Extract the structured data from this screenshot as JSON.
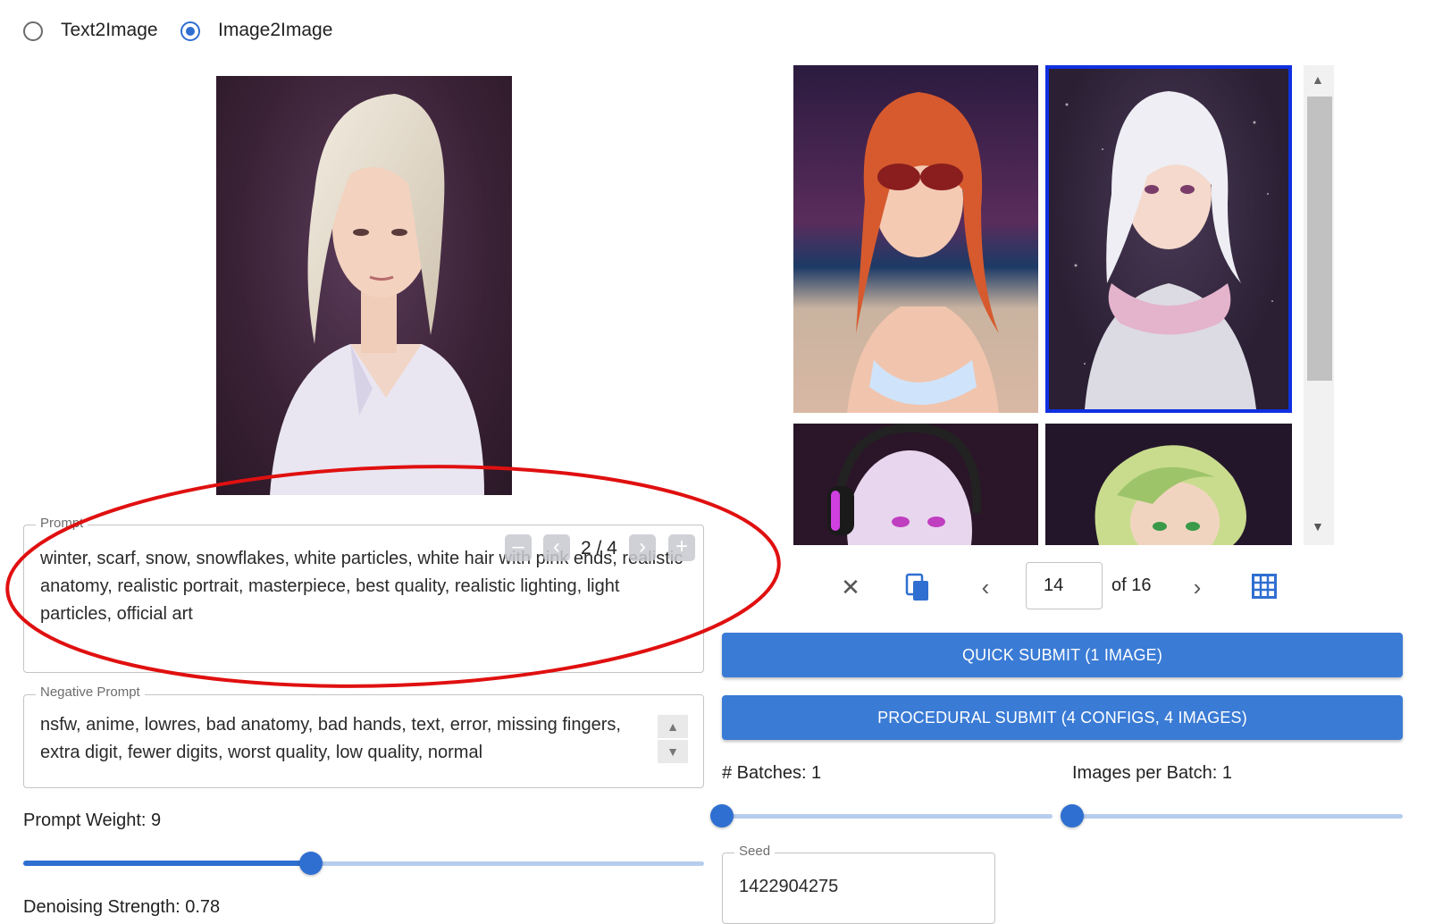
{
  "mode": {
    "options": [
      {
        "label": "Text2Image",
        "selected": false
      },
      {
        "label": "Image2Image",
        "selected": true
      }
    ]
  },
  "prompt": {
    "legend": "Prompt",
    "value": "winter, scarf, snow, snowflakes, white particles, white hair with pink ends, realistic anatomy, realistic portrait, masterpiece, best quality, realistic lighting, light particles, official art",
    "pager": {
      "current": 2,
      "total": 4,
      "text": "2 / 4"
    }
  },
  "negative_prompt": {
    "legend": "Negative Prompt",
    "value": "nsfw, anime, lowres, bad anatomy, bad hands, text, error, missing fingers, extra digit, fewer digits, worst quality, low quality, normal"
  },
  "prompt_weight": {
    "label": "Prompt Weight: 9",
    "value": 9,
    "fraction": 0.42
  },
  "denoising": {
    "label": "Denoising Strength: 0.78"
  },
  "gallery": {
    "page_value": "14",
    "of_text": "of 16",
    "current": 14,
    "total": 16,
    "selected_index": 1
  },
  "buttons": {
    "quick_submit": "QUICK SUBMIT (1 IMAGE)",
    "procedural_submit": "PROCEDURAL SUBMIT (4 CONFIGS, 4 IMAGES)"
  },
  "batches": {
    "label": "# Batches: 1",
    "value": 1,
    "fraction": 0.0
  },
  "images_per_batch": {
    "label": "Images per Batch: 1",
    "value": 1,
    "fraction": 0.0
  },
  "seed": {
    "legend": "Seed",
    "value": "1422904275"
  },
  "colors": {
    "accent": "#2f6fd1",
    "button": "#3a7bd5",
    "selection_border": "#1030e0",
    "annotation": "#e01010"
  },
  "icons": {
    "close": "close-icon",
    "copy": "copy-icon",
    "prev": "chevron-left-icon",
    "next": "chevron-right-icon",
    "grid": "grid-icon"
  }
}
